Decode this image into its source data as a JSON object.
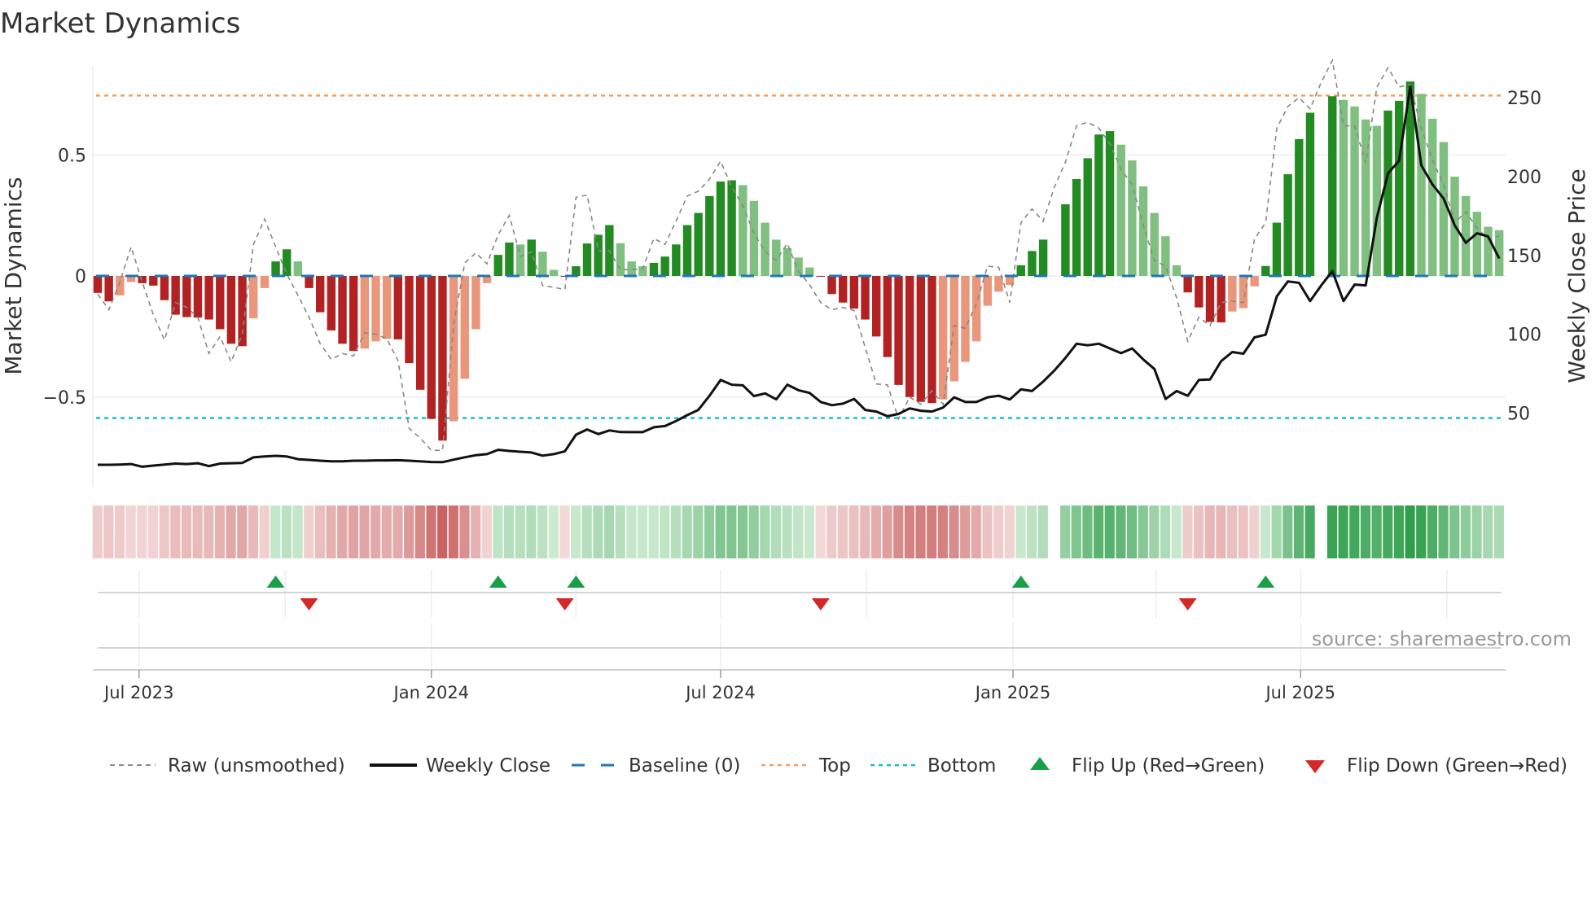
{
  "chart_data": {
    "type": "bar",
    "title": "Market Dynamics",
    "ylabel": "Market Dynamics",
    "ylabel_right": "Weekly Close Price",
    "ylim": [
      -0.88,
      0.98
    ],
    "ylim_right": [
      10,
      270
    ],
    "yticks": [
      {
        "value": 0.5,
        "label": "0.5"
      },
      {
        "value": 0,
        "label": "0"
      },
      {
        "value": -0.5,
        "label": "−0.5"
      }
    ],
    "yticks_right": [
      {
        "value": 50,
        "label": "50"
      },
      {
        "value": 100,
        "label": "100"
      },
      {
        "value": 150,
        "label": "150"
      },
      {
        "value": 200,
        "label": "200"
      },
      {
        "value": 250,
        "label": "250"
      }
    ],
    "x_start": "2023-06-05",
    "x_frequency": "weekly",
    "xticks": [
      {
        "date": "2023-07-01",
        "label": "Jul 2023"
      },
      {
        "date": "2024-01-01",
        "label": "Jan 2024"
      },
      {
        "date": "2024-07-01",
        "label": "Jul 2024"
      },
      {
        "date": "2025-01-01",
        "label": "Jan 2025"
      },
      {
        "date": "2025-07-01",
        "label": "Jul 2025"
      }
    ],
    "quarter_grid": [
      "2023-07-01",
      "2023-10-01",
      "2024-01-01",
      "2024-04-01",
      "2024-07-01",
      "2024-10-01",
      "2025-01-01",
      "2025-04-01",
      "2025-07-01",
      "2025-10-01"
    ],
    "top": 0.745,
    "bottom": -0.587,
    "baseline": 0,
    "grid": true,
    "legend_position": "bottom",
    "dynamics": [
      -0.07,
      -0.105,
      -0.08,
      -0.025,
      -0.03,
      -0.04,
      -0.1,
      -0.16,
      -0.17,
      -0.172,
      -0.18,
      -0.22,
      -0.28,
      -0.29,
      -0.175,
      -0.05,
      0.06,
      0.11,
      0.06,
      -0.05,
      -0.15,
      -0.225,
      -0.28,
      -0.31,
      -0.3,
      -0.27,
      -0.26,
      -0.262,
      -0.36,
      -0.47,
      -0.59,
      -0.68,
      -0.6,
      -0.425,
      -0.22,
      -0.03,
      0.087,
      0.138,
      0.13,
      0.15,
      0.1,
      0.025,
      -0.002,
      0.04,
      0.134,
      0.17,
      0.21,
      0.135,
      0.06,
      0.04,
      0.054,
      0.08,
      0.13,
      0.21,
      0.26,
      0.33,
      0.39,
      0.395,
      0.375,
      0.31,
      0.22,
      0.15,
      0.115,
      0.076,
      0.035,
      -0.002,
      -0.075,
      -0.11,
      -0.135,
      -0.18,
      -0.25,
      -0.335,
      -0.45,
      -0.5,
      -0.52,
      -0.525,
      -0.51,
      -0.435,
      -0.355,
      -0.27,
      -0.123,
      -0.065,
      -0.037,
      0.044,
      0.103,
      0.15,
      null,
      0.296,
      0.4,
      0.486,
      0.584,
      0.598,
      0.542,
      0.477,
      0.37,
      0.26,
      0.164,
      0.044,
      -0.068,
      -0.13,
      -0.19,
      -0.192,
      -0.147,
      -0.133,
      -0.043,
      0.041,
      0.22,
      0.42,
      0.565,
      0.674,
      null,
      0.742,
      0.727,
      0.7,
      0.646,
      0.62,
      0.683,
      0.723,
      0.803,
      0.752,
      0.649,
      0.553,
      0.41,
      0.33,
      0.265,
      0.203,
      0.189
    ],
    "raw": [
      -0.075,
      -0.14,
      -0.025,
      0.12,
      -0.025,
      -0.16,
      -0.265,
      -0.11,
      -0.13,
      -0.17,
      -0.32,
      -0.25,
      -0.355,
      -0.24,
      0.13,
      0.235,
      0.12,
      0.007,
      -0.08,
      -0.17,
      -0.28,
      -0.345,
      -0.32,
      -0.33,
      -0.235,
      -0.24,
      -0.26,
      -0.35,
      -0.63,
      -0.67,
      -0.72,
      -0.72,
      -0.2,
      0.054,
      0.095,
      0.05,
      0.17,
      0.25,
      0.08,
      0.1,
      -0.04,
      -0.047,
      -0.056,
      0.325,
      0.334,
      0.104,
      0.104,
      0.026,
      0.026,
      0.03,
      0.155,
      0.13,
      0.227,
      0.33,
      0.35,
      0.4,
      0.474,
      0.367,
      0.29,
      0.177,
      0.1,
      0.065,
      0.134,
      0.02,
      -0.036,
      -0.11,
      -0.14,
      -0.13,
      -0.143,
      -0.295,
      -0.446,
      -0.45,
      -0.59,
      -0.5,
      -0.53,
      -0.474,
      -0.53,
      -0.205,
      -0.216,
      -0.115,
      0.04,
      0.036,
      -0.11,
      0.22,
      0.277,
      0.226,
      0.366,
      0.47,
      0.62,
      0.635,
      0.61,
      0.546,
      0.44,
      0.377,
      0.21,
      0.064,
      0.04,
      -0.09,
      -0.27,
      -0.17,
      -0.205,
      -0.11,
      -0.104,
      -0.11,
      0.153,
      0.22,
      0.61,
      0.7,
      0.736,
      0.69,
      0.8,
      0.89,
      0.62,
      0.62,
      0.467,
      0.78,
      0.86,
      0.78,
      0.79,
      0.61,
      0.478,
      0.377,
      0.22,
      0.265,
      0.198,
      0.153,
      0.165
    ],
    "close": [
      17.2,
      17.2,
      17.4,
      17.7,
      16,
      16.7,
      17.4,
      18,
      17.7,
      18.2,
      16.4,
      18,
      18.2,
      18.4,
      21.9,
      22.5,
      22.9,
      22.5,
      20.8,
      20.3,
      19.8,
      19.4,
      19.4,
      19.8,
      19.8,
      20,
      20,
      20.1,
      19.8,
      19.4,
      19,
      18.9,
      20.5,
      22,
      23.3,
      24,
      26.7,
      26,
      25.5,
      25,
      23,
      24,
      25.8,
      36.3,
      39.6,
      36.7,
      39,
      38,
      37.9,
      37.9,
      41,
      41.8,
      45,
      48.7,
      52,
      61,
      71,
      68,
      67.6,
      60.8,
      62.5,
      58.7,
      68,
      64.5,
      62.8,
      57,
      55,
      56,
      59,
      52,
      51,
      48,
      49.5,
      53,
      51.5,
      51,
      53.5,
      60,
      57,
      57,
      60,
      61,
      58.6,
      65,
      64,
      70,
      77,
      85,
      94,
      93,
      94,
      91,
      88,
      91,
      84,
      78,
      59,
      64,
      61,
      71,
      71.3,
      83,
      88.7,
      87.7,
      98,
      99.7,
      124,
      133.5,
      132.6,
      121,
      131,
      140,
      121,
      131.5,
      131,
      174,
      202,
      210,
      257,
      207,
      195,
      186,
      169,
      158,
      164,
      162,
      148
    ],
    "flip_up_weeks": [
      17,
      37,
      44,
      84,
      106
    ],
    "flip_down_weeks": [
      20,
      43,
      66,
      99
    ],
    "colors": {
      "falling_negative": "#b22222",
      "rising_negative": "#e9967a",
      "rising_positive": "#228b22",
      "falling_positive": "#7fbf7f",
      "raw": "#888888",
      "close": "#111111",
      "baseline": "#1f77b4",
      "top": "#f0a060",
      "bottom": "#17becf",
      "flip_up": "#1a9e48",
      "flip_down": "#d62728"
    },
    "legend": [
      {
        "label": "Raw (unsmoothed)"
      },
      {
        "label": "Weekly Close"
      },
      {
        "label": "Baseline (0)"
      },
      {
        "label": "Top"
      },
      {
        "label": "Bottom"
      },
      {
        "label": "Flip Up (Red→Green)"
      },
      {
        "label": "Flip Down (Green→Red)"
      }
    ],
    "source": "source: sharemaestro.com"
  }
}
